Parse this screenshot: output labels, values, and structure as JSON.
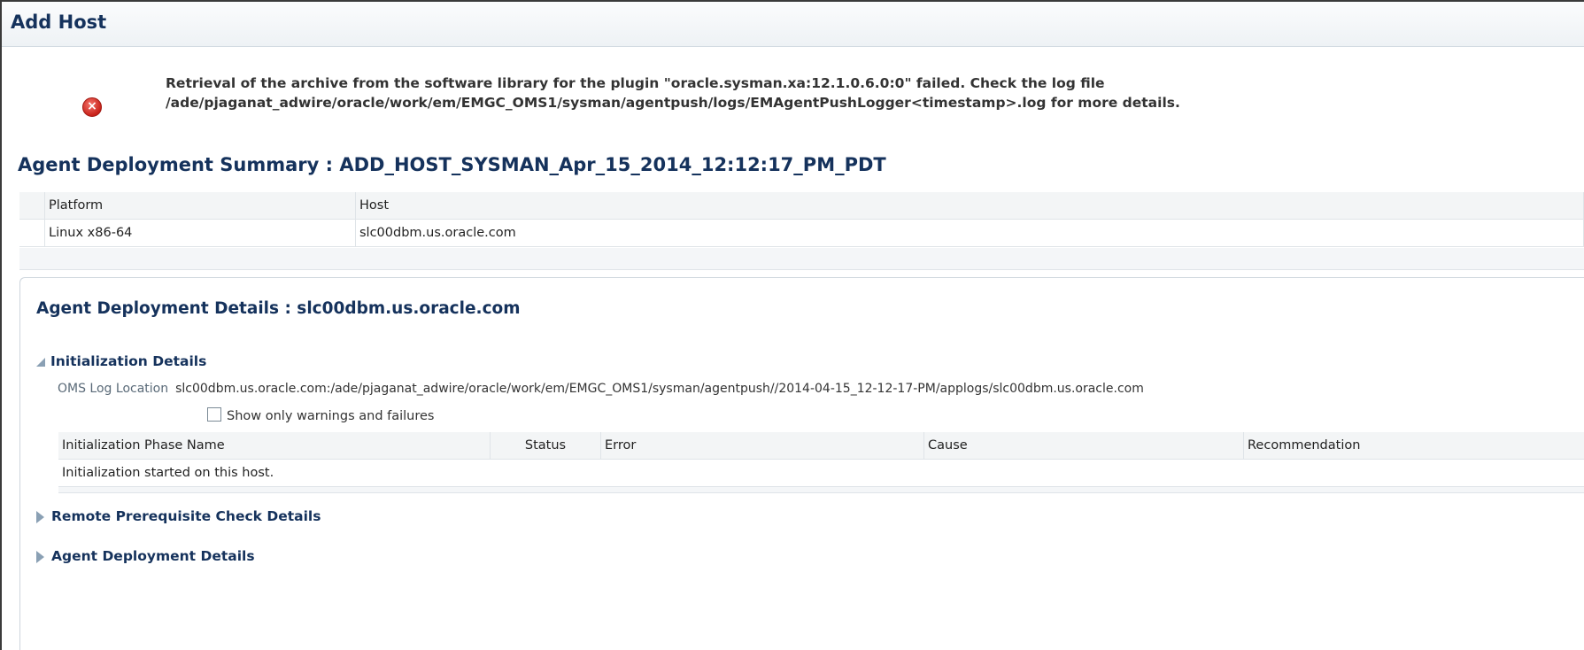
{
  "window": {
    "title": "Add Host"
  },
  "message": {
    "icon": "error-icon",
    "text": "Retrieval of the archive from the software library for the plugin \"oracle.sysman.xa:12.1.0.6.0:0\" failed. Check the log file /ade/pjaganat_adwire/oracle/work/em/EMGC_OMS1/sysman/agentpush/logs/EMAgentPushLogger<timestamp>.log for more details."
  },
  "summary": {
    "title": "Agent Deployment Summary : ADD_HOST_SYSMAN_Apr_15_2014_12:12:17_PM_PDT",
    "columns": [
      "Platform",
      "Host"
    ],
    "rows": [
      {
        "platform": "Linux x86-64",
        "host": "slc00dbm.us.oracle.com"
      }
    ]
  },
  "details": {
    "title": "Agent Deployment Details : slc00dbm.us.oracle.com",
    "init_section": {
      "label": "Initialization Details",
      "oms_log_label": "OMS Log Location",
      "oms_log_value": "slc00dbm.us.oracle.com:/ade/pjaganat_adwire/oracle/work/em/EMGC_OMS1/sysman/agentpush//2014-04-15_12-12-17-PM/applogs/slc00dbm.us.oracle.com",
      "checkbox_label": "Show only warnings and failures",
      "checkbox_checked": false,
      "columns": [
        "Initialization Phase Name",
        "Status",
        "Error",
        "Cause",
        "Recommendation"
      ],
      "rows": [
        {
          "phase": "Initialization started on this host."
        }
      ]
    },
    "collapsed_sections": [
      {
        "label": "Remote Prerequisite Check Details"
      },
      {
        "label": "Agent Deployment Details"
      }
    ]
  }
}
